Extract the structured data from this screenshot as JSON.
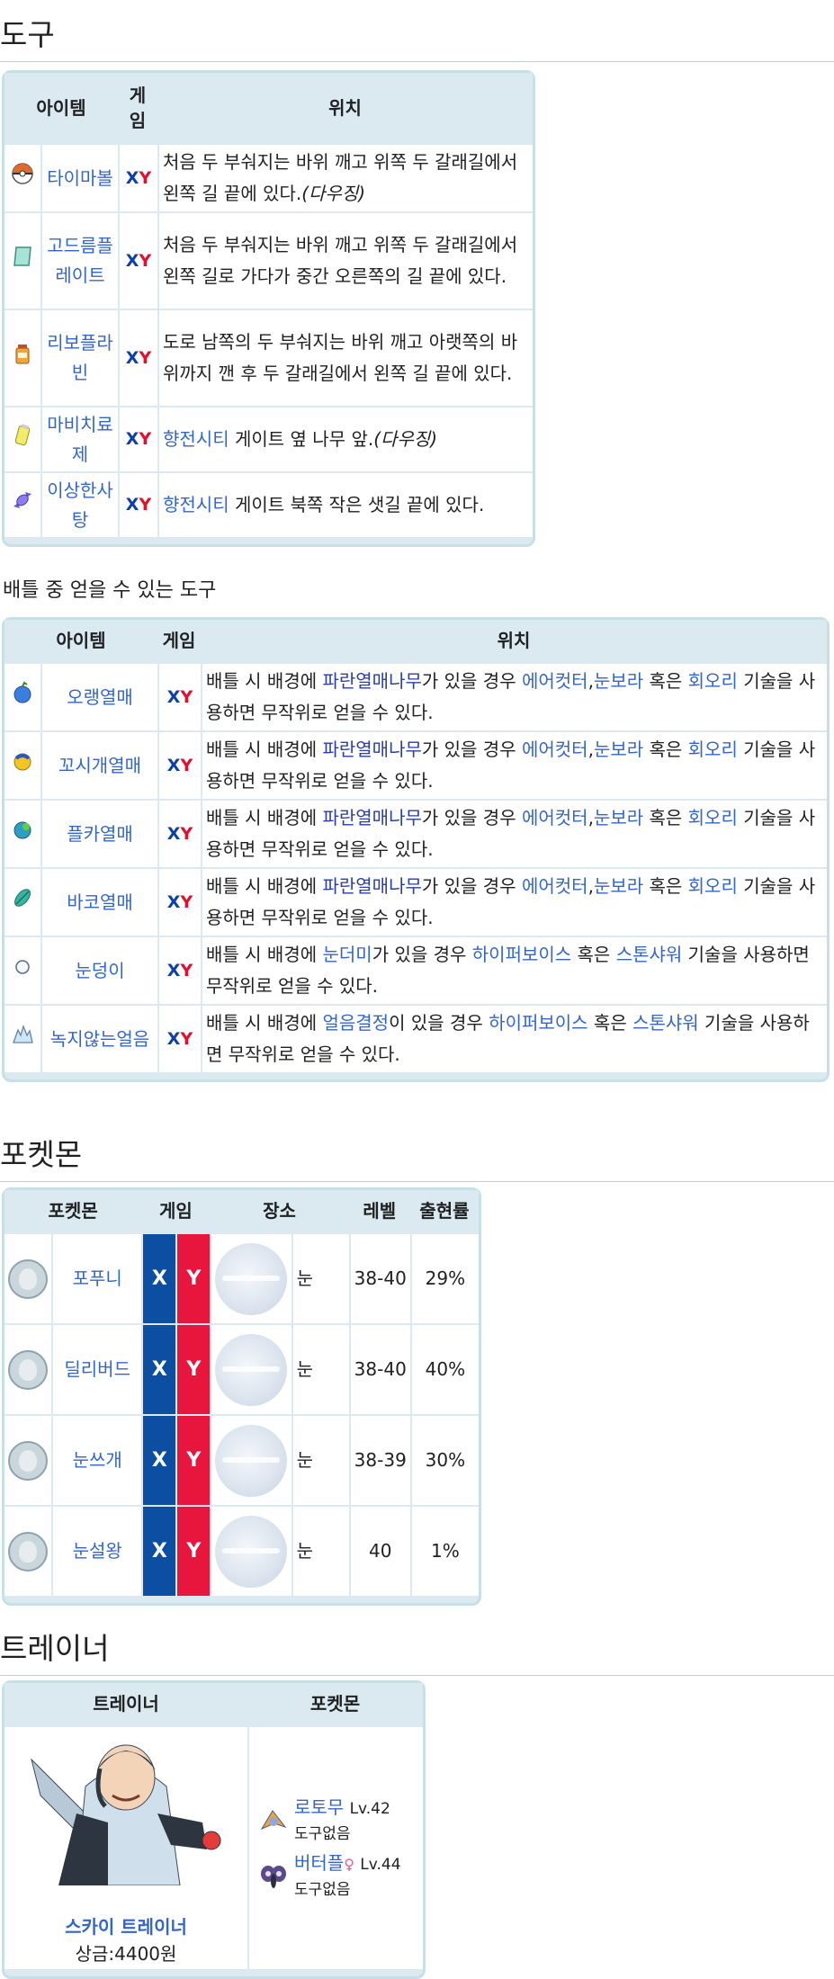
{
  "tools": {
    "heading": "도구",
    "headers": {
      "item": "아이템",
      "game": "게임",
      "location": "위치"
    },
    "game_x": "X",
    "game_y": "Y",
    "rows": [
      {
        "icon": "timer-ball-icon",
        "name": "타이마볼",
        "loc_text": "처음 두 부숴지는 바위 깨고 위쪽 두 갈래길에서 왼쪽 길 끝에 있다.",
        "loc_note": "(다우징)"
      },
      {
        "icon": "gold-plate-icon",
        "name": "고드름플레이트",
        "loc_text": "처음 두 부숴지는 바위 깨고 위쪽 두 갈래길에서 왼쪽 길로 가다가 중간 오른쪽의 길 끝에 있다.",
        "loc_note": ""
      },
      {
        "icon": "revive-icon",
        "name": "리보플라빈",
        "loc_text": "도로 남쪽의 두 부숴지는 바위 깨고 아랫쪽의 바위까지 깬 후 두 갈래길에서 왼쪽 길 끝에 있다.",
        "loc_note": ""
      },
      {
        "icon": "paralyze-heal-icon",
        "name": "마비치료제",
        "loc_link": "향전시티",
        "loc_text": " 게이트 옆 나무 앞.",
        "loc_note": "(다우징)"
      },
      {
        "icon": "rare-candy-icon",
        "name": "이상한사탕",
        "loc_link": "향전시티",
        "loc_text": " 게이트 북쪽 작은 샛길 끝에 있다.",
        "loc_note": ""
      }
    ]
  },
  "battle_tools": {
    "heading": "배틀 중 얻을 수 있는 도구",
    "headers": {
      "item": "아이템",
      "game": "게임",
      "location": "위치"
    },
    "rows": [
      {
        "icon": "oran-berry-icon",
        "name": "오랭열매"
      },
      {
        "icon": "sitrus-berry-icon",
        "name": "꼬시개열매"
      },
      {
        "icon": "pecha-berry-icon",
        "name": "플카열매"
      },
      {
        "icon": "rawst-berry-icon",
        "name": "바코열매"
      },
      {
        "icon": "snowball-icon",
        "name": "눈덩이"
      },
      {
        "icon": "never-melt-ice-icon",
        "name": "녹지않는얼음"
      }
    ],
    "berry_text": {
      "a": "배틀 시 배경에 ",
      "tree": "파란열매나무",
      "b": "가 있을 경우 ",
      "m1": "에어컷터",
      "comma": ",",
      "m2": "눈보라",
      "c": " 혹은 ",
      "m3": "회오리",
      "d": " 기술을 사용하면 무작위로 얻을 수 있다."
    },
    "snow_text": {
      "a": "배틀 시 배경에 ",
      "bg": "눈더미",
      "b": "가 있을 경우 ",
      "m1": "하이퍼보이스",
      "c": " 혹은 ",
      "m2": "스톤샤워",
      "d": " 기술을 사용하면 무작위로 얻을 수 있다."
    },
    "ice_text": {
      "a": "배틀 시 배경에 ",
      "bg": "얼음결정",
      "b": "이 있을 경우 ",
      "m1": "하이퍼보이스",
      "c": " 혹은 ",
      "m2": "스톤샤워",
      "d": " 기술을 사용하면 무작위로 얻을 수 있다."
    }
  },
  "pokemon": {
    "heading": "포켓몬",
    "headers": {
      "pokemon": "포켓몬",
      "game": "게임",
      "place": "장소",
      "level": "레벨",
      "rate": "출현률"
    },
    "rows": [
      {
        "icon": "bergmite-icon",
        "name": "포푸니",
        "place": "눈",
        "level": "38-40",
        "rate": "29%"
      },
      {
        "icon": "delibird-icon",
        "name": "딜리버드",
        "place": "눈",
        "level": "38-40",
        "rate": "40%"
      },
      {
        "icon": "snover-icon",
        "name": "눈쓰개",
        "place": "눈",
        "level": "38-39",
        "rate": "30%"
      },
      {
        "icon": "abomasnow-icon",
        "name": "눈설왕",
        "place": "눈",
        "level": "40",
        "rate": "1%"
      }
    ]
  },
  "trainers": {
    "heading": "트레이너",
    "headers": {
      "trainer": "트레이너",
      "pokemon": "포켓몬"
    },
    "trainer_class": "스카이 트레이너",
    "prize": "상금:4400원",
    "team": [
      {
        "icon": "rotom-icon",
        "name": "로토무",
        "level": "Lv.42",
        "item": "도구없음",
        "gender": ""
      },
      {
        "icon": "vivillon-icon",
        "name": "버터플",
        "level": "Lv.44",
        "item": "도구없음",
        "gender": "♀"
      }
    ]
  }
}
